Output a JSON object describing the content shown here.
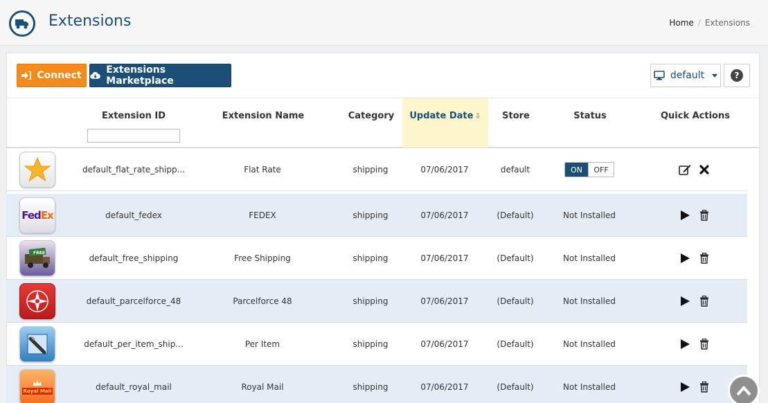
{
  "header": {
    "title": "Extensions",
    "breadcrumb": {
      "home": "Home",
      "separator": "/",
      "current": "Extensions"
    }
  },
  "toolbar": {
    "connect_label": "Connect",
    "marketplace_label": "Extensions Marketplace",
    "store_select_label": "default",
    "help_label": "?"
  },
  "table": {
    "columns": {
      "extension_id": "Extension ID",
      "extension_name": "Extension Name",
      "category": "Category",
      "update_date": "Update Date",
      "store": "Store",
      "status": "Status",
      "quick_actions": "Quick Actions"
    },
    "sort_arrow": "⇩",
    "filter_value": "",
    "toggle_on": "ON",
    "toggle_off": "OFF",
    "rows": [
      {
        "icon": "star-icon",
        "id": "default_flat_rate_shipp...",
        "name": "Flat Rate",
        "category": "shipping",
        "date": "07/06/2017",
        "store": "default",
        "status": "toggle",
        "actions": [
          "edit",
          "delete"
        ]
      },
      {
        "icon": "fedex-logo",
        "logo_text_a": "Fed",
        "logo_text_b": "Ex",
        "id": "default_fedex",
        "name": "FEDEX",
        "category": "shipping",
        "date": "07/06/2017",
        "store": "(Default)",
        "status": "Not Installed",
        "actions": [
          "install",
          "trash"
        ]
      },
      {
        "icon": "free-shipping-truck-icon",
        "logo_text": "FREE",
        "id": "default_free_shipping",
        "name": "Free Shipping",
        "category": "shipping",
        "date": "07/06/2017",
        "store": "(Default)",
        "status": "Not Installed",
        "actions": [
          "install",
          "trash"
        ]
      },
      {
        "icon": "parcelforce-logo",
        "id": "default_parcelforce_48",
        "name": "Parcelforce 48",
        "category": "shipping",
        "date": "07/06/2017",
        "store": "(Default)",
        "status": "Not Installed",
        "actions": [
          "install",
          "trash"
        ]
      },
      {
        "icon": "per-item-icon",
        "id": "default_per_item_ship...",
        "name": "Per Item",
        "category": "shipping",
        "date": "07/06/2017",
        "store": "(Default)",
        "status": "Not Installed",
        "actions": [
          "install",
          "trash"
        ]
      },
      {
        "icon": "royal-mail-logo",
        "logo_text": "Royal Mail",
        "id": "default_royal_mail",
        "name": "Royal Mail",
        "category": "shipping",
        "date": "07/06/2017",
        "store": "(Default)",
        "status": "Not Installed",
        "actions": [
          "install",
          "trash"
        ]
      }
    ]
  },
  "colors": {
    "primary": "#1c4f78",
    "accent": "#f58b1c",
    "row_alt": "#e4edf6",
    "sorted_header": "#fdf5cc"
  }
}
